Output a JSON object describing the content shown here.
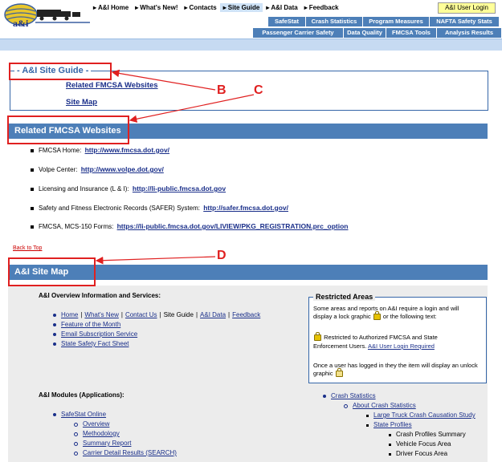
{
  "header": {
    "logo_text": "a&i",
    "top_nav": [
      {
        "label": "A&I Home",
        "selected": false
      },
      {
        "label": "What's New!",
        "selected": false
      },
      {
        "label": "Contacts",
        "selected": false
      },
      {
        "label": "Site Guide",
        "selected": true
      },
      {
        "label": "A&I Data",
        "selected": false
      },
      {
        "label": "Feedback",
        "selected": false
      }
    ],
    "login_button": "A&I User Login",
    "tabs_row1": [
      "SafeStat",
      "Crash Statistics",
      "Program Measures",
      "NAFTA Safety Stats"
    ],
    "tabs_row2": [
      "Passenger Carrier Safety",
      "Data Quality",
      "FMCSA Tools",
      "Analysis Results"
    ]
  },
  "site_guide": {
    "title": "A&I Site Guide",
    "links": [
      "Related FMCSA Websites",
      "Site Map"
    ]
  },
  "related": {
    "title": "Related FMCSA Websites",
    "items": [
      {
        "label": "FMCSA Home:",
        "url": "http://www.fmcsa.dot.gov/"
      },
      {
        "label": "Volpe Center:",
        "url": "http://www.volpe.dot.gov/"
      },
      {
        "label": "Licensing and Insurance (L & I):",
        "url": "http://li-public.fmcsa.dot.gov"
      },
      {
        "label": "Safety and Fitness Electronic Records (SAFER) System:",
        "url": "http://safer.fmcsa.dot.gov/"
      },
      {
        "label": "FMCSA, MCS-150 Forms:",
        "url": "https://li-public.fmcsa.dot.gov/LIVIEW/PKG_REGISTRATION.prc_option"
      }
    ]
  },
  "back_to_top": "Back to Top",
  "site_map": {
    "title": "A&I Site Map",
    "overview_heading": "A&I Overview Information and Services:",
    "overview_inline": [
      "Home",
      "What's New",
      "Contact Us",
      "Site Guide",
      "A&I Data",
      "Feedback"
    ],
    "overview_links": [
      "Feature of the Month",
      "Email Subscription Service",
      "State Safety Fact Sheet"
    ],
    "modules_heading": "A&I Modules (Applications):",
    "safestat": "SafeStat Online",
    "safestat_sub": [
      "Overview",
      "Methodology",
      "Summary Report",
      "Carrier Detail Results (SEARCH)"
    ],
    "crash_stats": "Crash Statistics",
    "about_crash": "About Crash Statistics",
    "crash_sub": [
      "Large Truck Crash Causation Study",
      "State Profiles"
    ],
    "state_profiles_sub": [
      "Crash Profiles Summary",
      "Vehicle Focus Area",
      "Driver Focus Area"
    ]
  },
  "restricted": {
    "title": "Restricted Areas",
    "line1": "Some areas and reports on A&I require a login and will",
    "line2a": "display a lock graphic",
    "line2b": "or the following text:",
    "line3": "Restricted to Authorized FMCSA and State",
    "line4": "Enforcement Users.",
    "login_link": "A&I User Login Required",
    "line5": "Once a user has logged in they the item will display an unlock",
    "line6": "graphic"
  },
  "annotations": [
    "B",
    "C",
    "D"
  ],
  "colors": {
    "accent": "#4d7fb8",
    "annotation": "#e02020",
    "link": "#1a2f8a"
  }
}
